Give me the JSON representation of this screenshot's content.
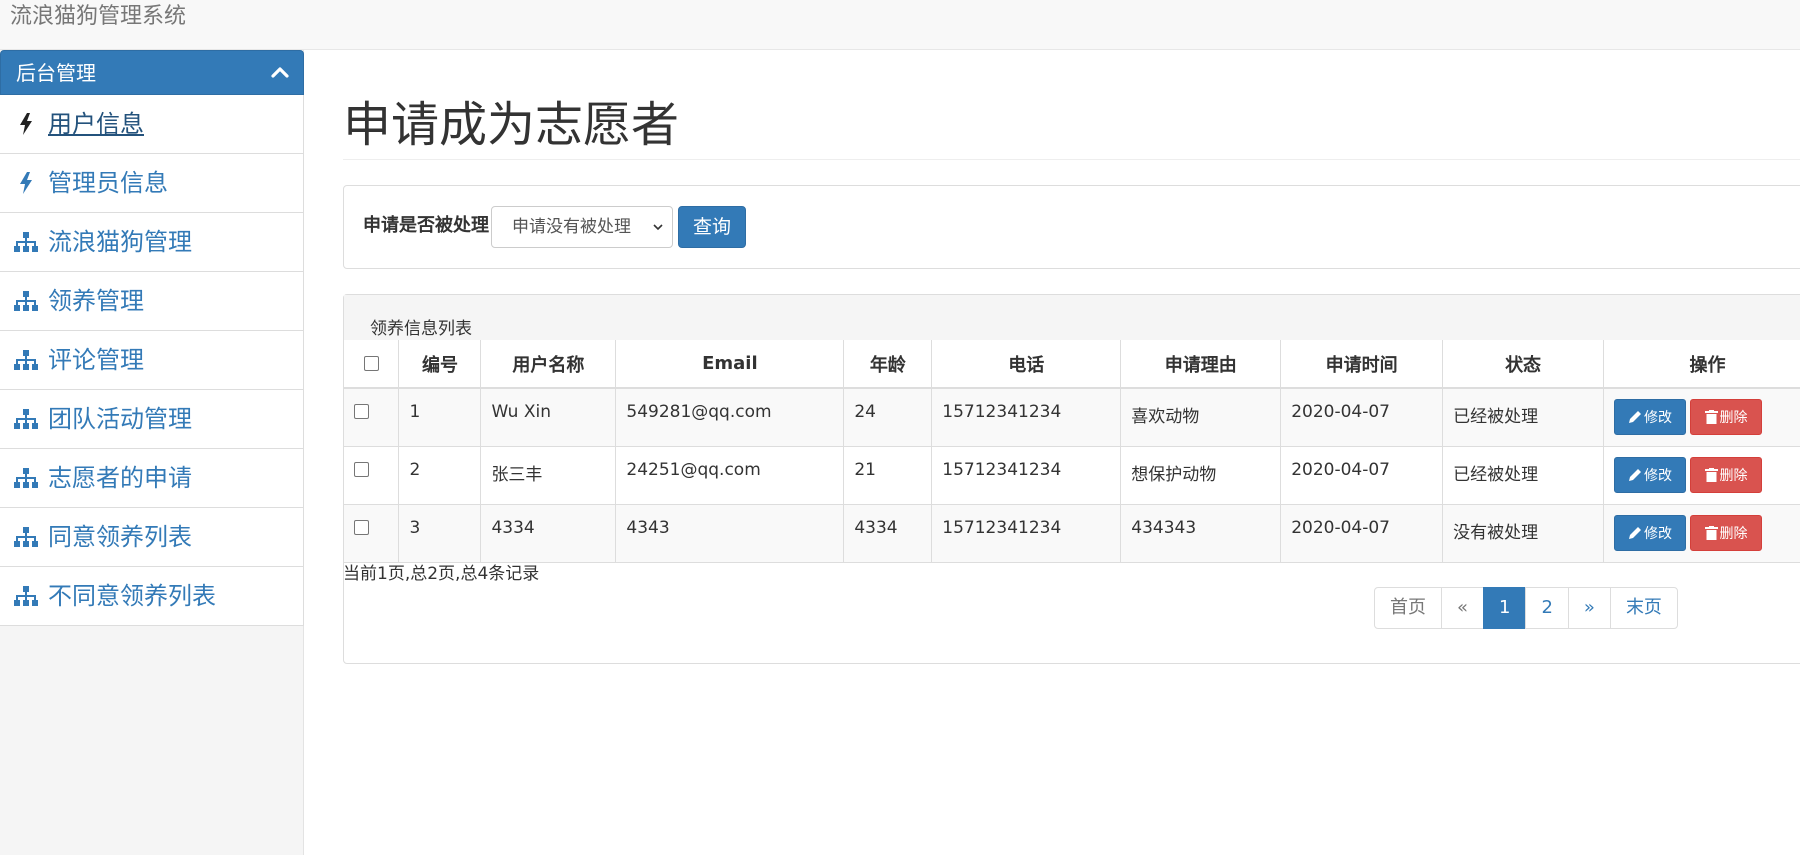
{
  "app": {
    "title": "流浪猫狗管理系统"
  },
  "sidebar": {
    "heading": "后台管理",
    "items": [
      {
        "label": "用户信息",
        "icon": "bolt-icon"
      },
      {
        "label": "管理员信息",
        "icon": "bolt-icon"
      },
      {
        "label": "流浪猫狗管理",
        "icon": "sitemap-icon"
      },
      {
        "label": "领养管理",
        "icon": "sitemap-icon"
      },
      {
        "label": "评论管理",
        "icon": "sitemap-icon"
      },
      {
        "label": "团队活动管理",
        "icon": "sitemap-icon"
      },
      {
        "label": "志愿者的申请",
        "icon": "sitemap-icon"
      },
      {
        "label": "同意领养列表",
        "icon": "sitemap-icon"
      },
      {
        "label": "不同意领养列表",
        "icon": "sitemap-icon"
      }
    ]
  },
  "main": {
    "title": "申请成为志愿者",
    "filter": {
      "label": "申请是否被处理",
      "selected": "申请没有被处理",
      "query_label": "查询"
    },
    "list": {
      "title": "领养信息列表",
      "headers": [
        "编号",
        "用户名称",
        "Email",
        "年龄",
        "电话",
        "申请理由",
        "申请时间",
        "状态",
        "操作"
      ],
      "rows": [
        [
          "1",
          "Wu Xin",
          "549281@qq.com",
          "24",
          "15712341234",
          "喜欢动物",
          "2020-04-07",
          "已经被处理"
        ],
        [
          "2",
          "张三丰",
          "24251@qq.com",
          "21",
          "15712341234",
          "想保护动物",
          "2020-04-07",
          "已经被处理"
        ],
        [
          "3",
          "4334",
          "4343",
          "4334",
          "15712341234",
          "434343",
          "2020-04-07",
          "没有被处理"
        ]
      ],
      "edit_label": "修改",
      "delete_label": "删除"
    },
    "page_info": "当前1页,总2页,总4条记录",
    "pager": {
      "first": "首页",
      "prev": "«",
      "pages": [
        "1",
        "2"
      ],
      "current": "1",
      "next": "»",
      "last": "末页"
    }
  },
  "colors": {
    "primary": "#337ab7",
    "danger": "#d9534f",
    "navbar_bg": "#f8f8f8"
  }
}
